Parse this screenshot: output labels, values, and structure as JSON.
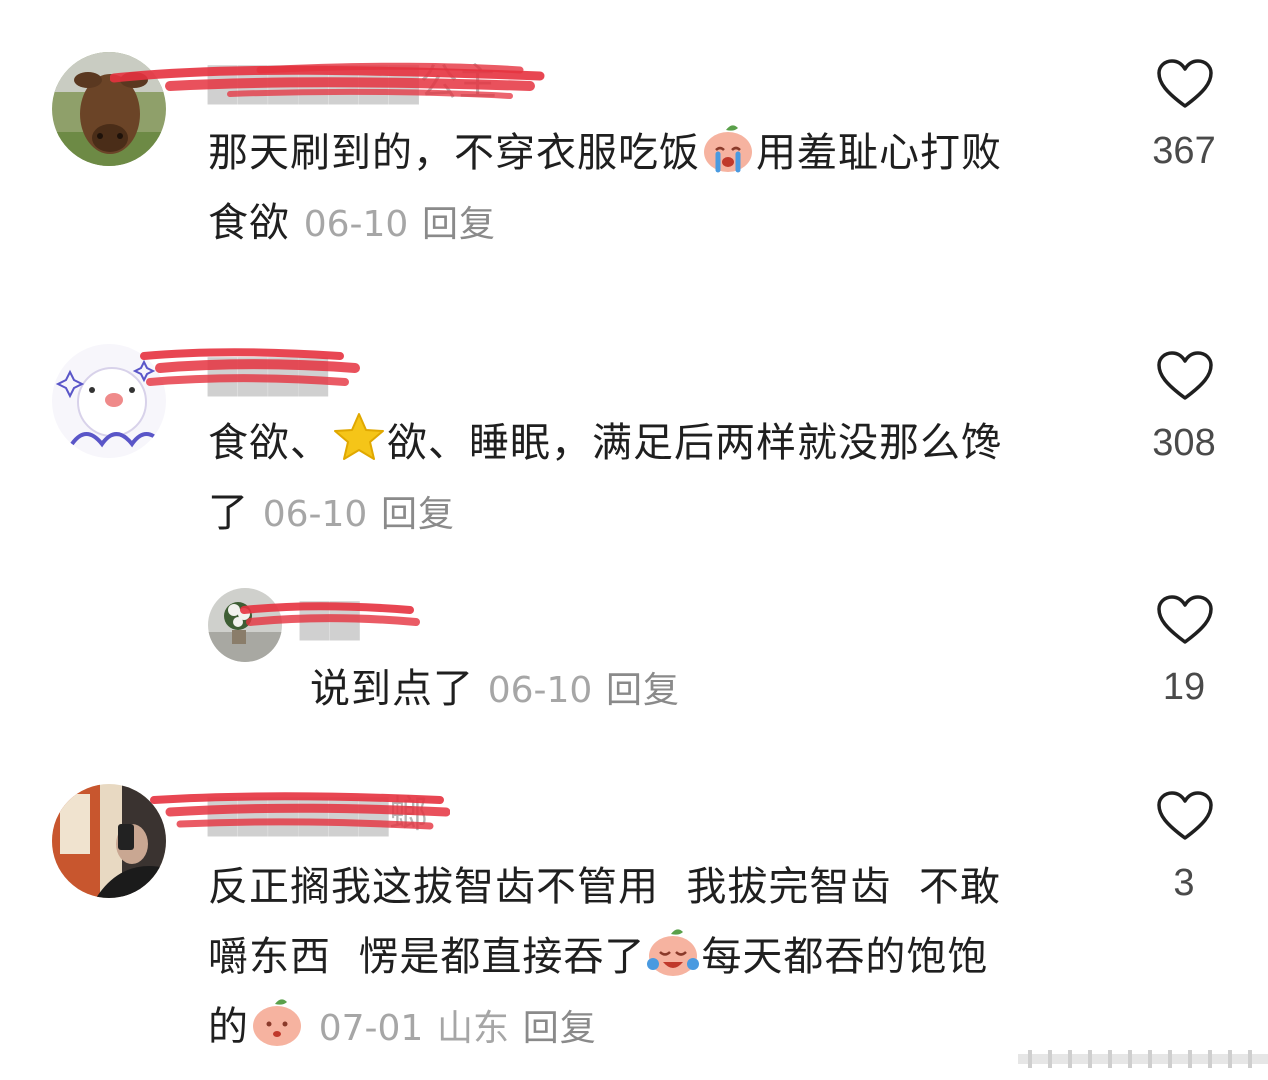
{
  "comments": [
    {
      "username": "公主",
      "line1_a": "那天刷到的，不穿衣服吃饭",
      "line1_emoji": "crying-peach-emoji",
      "line1_b": "用羞耻心打败",
      "line2": "食欲",
      "date": "06-10",
      "reply": "回复",
      "likes": "367"
    },
    {
      "username": "",
      "line1_a": "食欲、",
      "line1_emoji": "star-emoji",
      "line1_b": "欲、睡眠，满足后两样就没那么馋",
      "line2": "了",
      "date": "06-10",
      "reply": "回复",
      "likes": "308"
    },
    {
      "username": "",
      "line1": "说到点了",
      "date": "06-10",
      "reply": "回复",
      "likes": "19"
    },
    {
      "username": "螂",
      "line1": "反正搁我这拔智齿不管用  我拔完智齿  不敢",
      "line2_a": "嚼东西  愣是都直接吞了",
      "line2_emoji": "laugh-crying-peach-emoji",
      "line2_b": "每天都吞的饱饱",
      "line3": "的",
      "line3_emoji": "peach-emoji",
      "date": "07-01",
      "location": "山东",
      "reply": "回复",
      "likes": "3"
    }
  ],
  "colors": {
    "text": "#1f1f1f",
    "meta": "#a6a6a6",
    "username": "#b5b5b5",
    "redaction": "#e5323f"
  }
}
